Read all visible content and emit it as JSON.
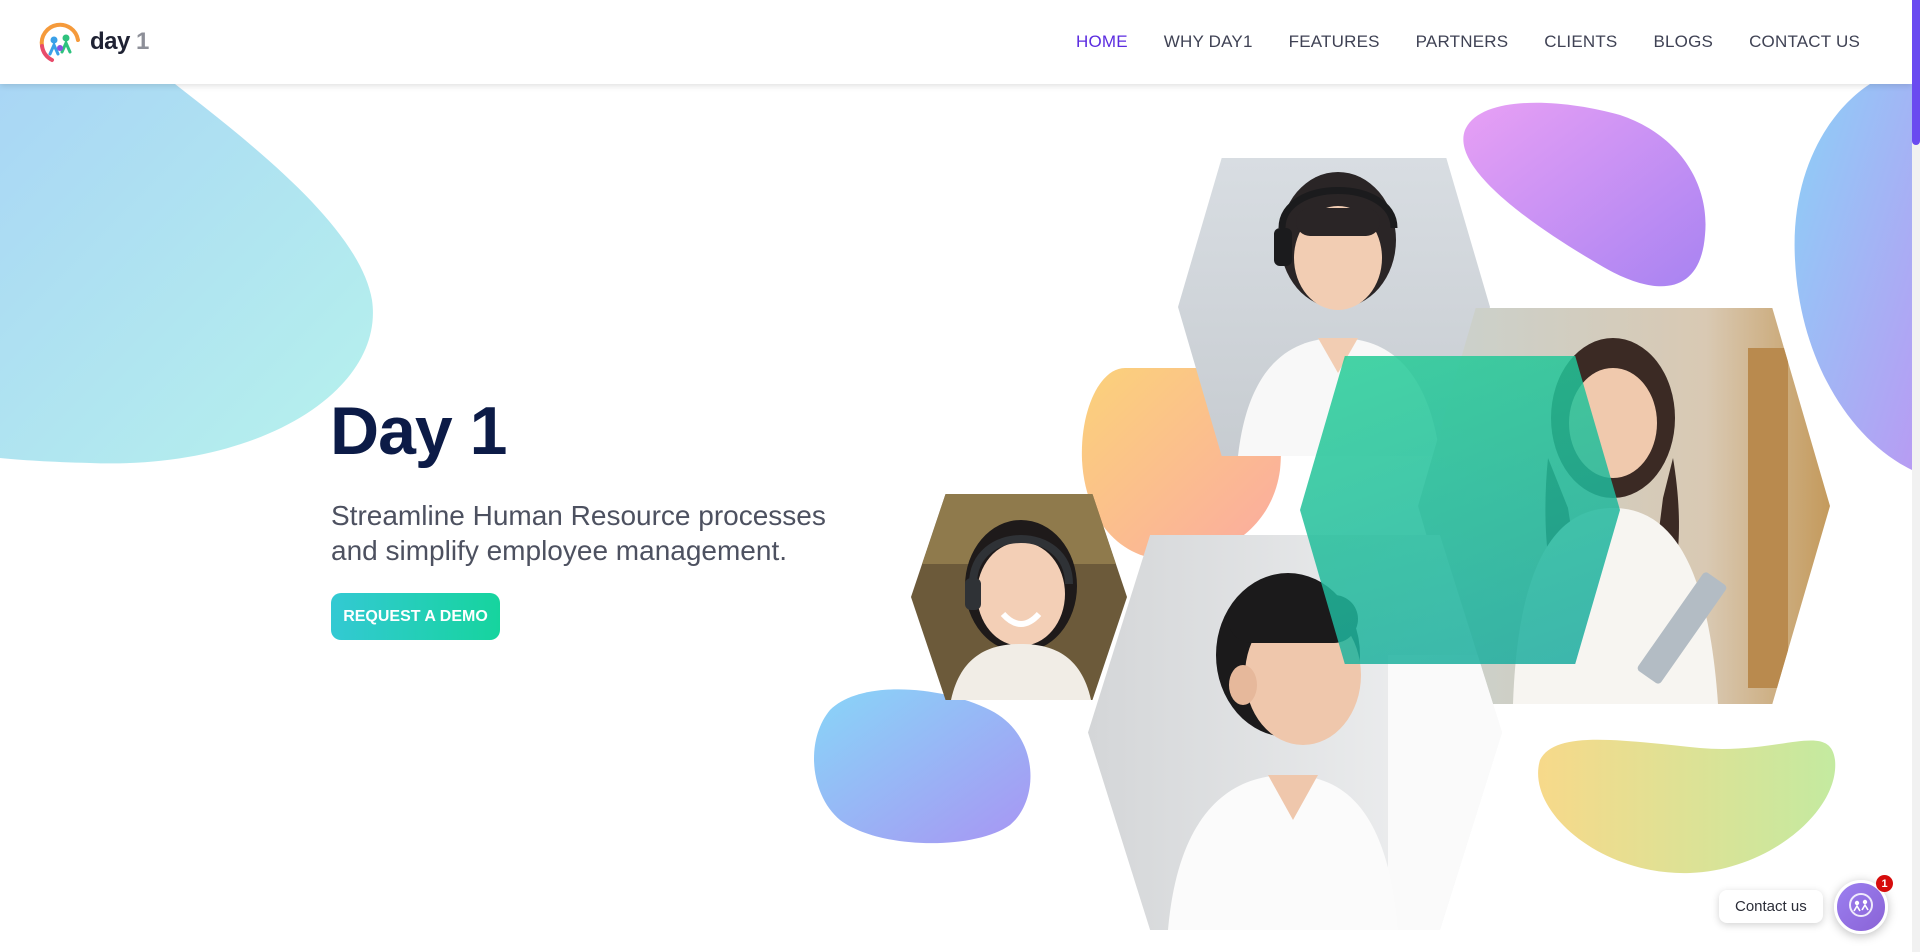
{
  "brand": {
    "name": "day",
    "number": "1",
    "logo_icon": "day1-logo-icon"
  },
  "nav": {
    "items": [
      {
        "label": "HOME",
        "active": true
      },
      {
        "label": "WHY DAY1",
        "active": false
      },
      {
        "label": "FEATURES",
        "active": false
      },
      {
        "label": "PARTNERS",
        "active": false
      },
      {
        "label": "CLIENTS",
        "active": false
      },
      {
        "label": "BLOGS",
        "active": false
      },
      {
        "label": "CONTACT US",
        "active": false
      }
    ]
  },
  "hero": {
    "title": "Day 1",
    "subtitle_line1": "Streamline Human Resource processes",
    "subtitle_line2": "and simplify employee management.",
    "cta_label": "REQUEST A DEMO"
  },
  "contact_widget": {
    "label": "Contact us",
    "badge_count": "1",
    "icon": "day1-chat-icon"
  },
  "colors": {
    "accent_nav": "#5b2be0",
    "title": "#0c1b47",
    "cta_gradient_start": "#33c9d3",
    "cta_gradient_end": "#16d49e",
    "badge": "#d60c0c"
  }
}
